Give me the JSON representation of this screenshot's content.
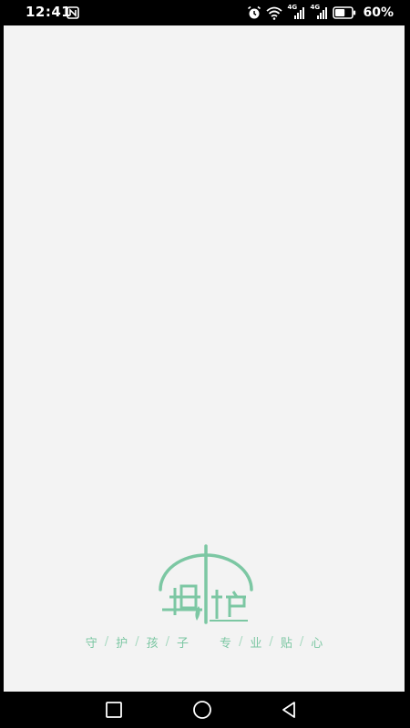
{
  "status_bar": {
    "time": "12:41",
    "battery_percent": "60%",
    "battery_level": 0.6,
    "network_labels": [
      "4G",
      "4G"
    ],
    "icons": [
      "nfc-icon",
      "alarm-icon",
      "wifi-icon",
      "signal-icon",
      "signal-icon",
      "battery-icon"
    ]
  },
  "splash": {
    "logo_icon": "umbrella-logo",
    "slogan_left": [
      "守",
      "护",
      "孩",
      "子"
    ],
    "slogan_right": [
      "专",
      "业",
      "贴",
      "心"
    ],
    "slogan_separator": "/",
    "accent_color": "#7cc7a3",
    "background_color": "#f3f3f3"
  },
  "nav_bar": {
    "buttons": [
      "recent-apps",
      "home",
      "back"
    ]
  }
}
